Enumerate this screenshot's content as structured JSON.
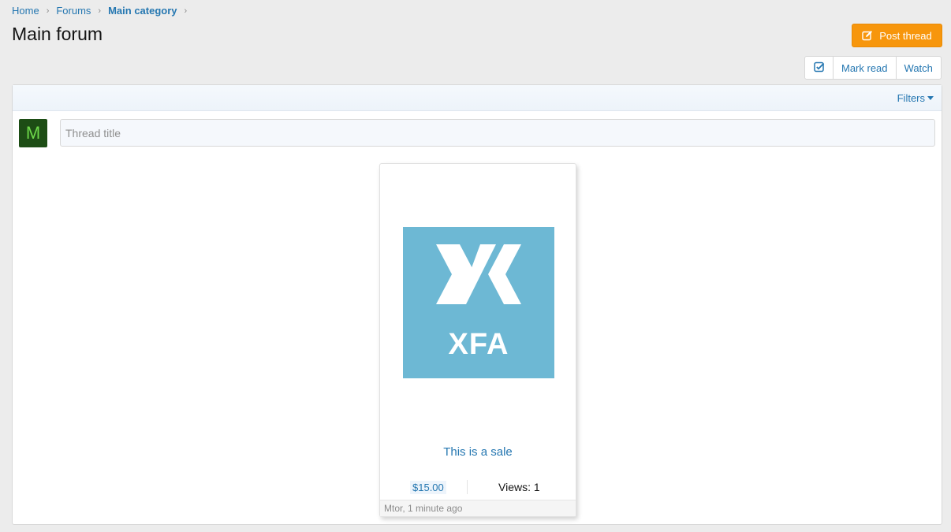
{
  "breadcrumb": {
    "items": [
      {
        "label": "Home"
      },
      {
        "label": "Forums"
      },
      {
        "label": "Main category"
      }
    ],
    "separator": "›"
  },
  "page": {
    "title": "Main forum"
  },
  "actions": {
    "post_thread_label": "Post thread",
    "mark_read_label": "Mark read",
    "watch_label": "Watch",
    "accent_color": "#f7960c"
  },
  "panel": {
    "filters_label": "Filters"
  },
  "quick_thread": {
    "avatar_letter": "M",
    "placeholder": "Thread title",
    "value": ""
  },
  "thread_card": {
    "logo_text": "XFA",
    "title": "This is a sale",
    "price": "$15.00",
    "views": "Views: 1",
    "meta": "Mtor, 1 minute ago",
    "thumb_color": "#6db8d4"
  }
}
